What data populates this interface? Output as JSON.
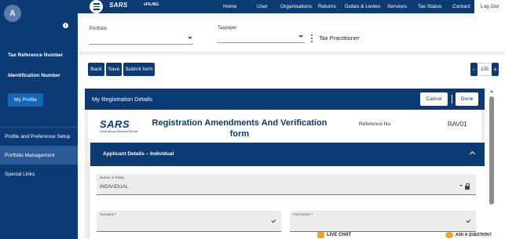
{
  "sidebar": {
    "avatar_initial": "A",
    "info_icon": "i",
    "tax_reference_label": "Tax Reference Number",
    "identification_label": "Identification Number",
    "profile_button": "My Profile",
    "nav": [
      {
        "label": "Profile and Preference Setup"
      },
      {
        "label": "Portfolio Management"
      },
      {
        "label": "Special Links"
      }
    ]
  },
  "topnav": {
    "logo": "SARS",
    "logo_sub": "eFILING",
    "items": [
      "Home",
      "User",
      "Organisations",
      "Returns",
      "Duties & Levies",
      "Services",
      "Tax Status",
      "Contact"
    ],
    "logout": "Log Out"
  },
  "filters": {
    "portfolio_label": "Portfolio",
    "taxpayer_label": "Taxpayer",
    "tax_practitioner": "Tax Practitioner"
  },
  "toolbar": {
    "back": "Back",
    "save": "Save",
    "submit": "Submit form",
    "zoom_minus": "-",
    "zoom_value": "100",
    "zoom_plus": "+"
  },
  "panel": {
    "title": "My Registration Details",
    "cancel": "Cancel",
    "done": "Done"
  },
  "form": {
    "logo": "SARS",
    "logo_sub": "South African Revenue Service",
    "title": "Registration Amendments And Verification form",
    "reference_label": "Reference No.",
    "reference_value": "RAV01",
    "section_title": "Applicant Details – Individual",
    "nature_of_entity_label": "Nature of Entity",
    "nature_of_entity_value": "INDIVIDUAL",
    "surname_label": "Surname *",
    "first_name_label": "First Name *"
  },
  "helpers": {
    "live_chat": "LIVE CHAT",
    "ask_question": "ASK A QUESTION?"
  },
  "colors": {
    "navy": "#0c3a73",
    "button_blue": "#1566b7",
    "active_nav": "#2a5b96"
  }
}
